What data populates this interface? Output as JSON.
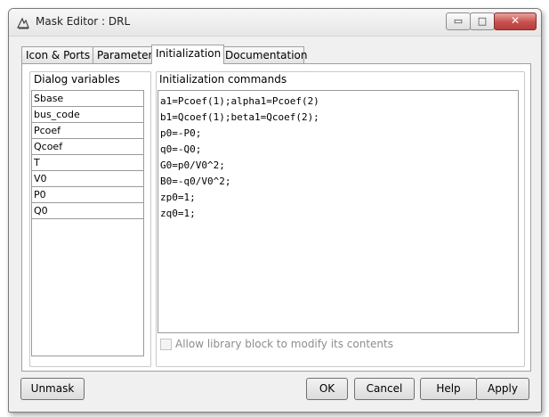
{
  "window": {
    "title": "Mask Editor : DRL"
  },
  "title_buttons": {
    "minimize": "▭",
    "maximize": "□",
    "close": "✕"
  },
  "tabs": [
    {
      "label": "Icon & Ports"
    },
    {
      "label": "Parameters"
    },
    {
      "label": "Initialization",
      "active": true
    },
    {
      "label": "Documentation"
    }
  ],
  "dialog_variables": {
    "label": "Dialog variables",
    "items": [
      "Sbase",
      "bus_code",
      "Pcoef",
      "Qcoef",
      "T",
      "V0",
      "P0",
      "Q0"
    ]
  },
  "init_commands": {
    "label": "Initialization commands",
    "lines": [
      "a1=Pcoef(1);alpha1=Pcoef(2)",
      "b1=Qcoef(1);beta1=Qcoef(2);",
      "p0=-P0;",
      "q0=-Q0;",
      "G0=p0/V0^2;",
      "B0=-q0/V0^2;",
      "zp0=1;",
      "zq0=1;"
    ]
  },
  "allow_library_label": "Allow library block to modify its contents",
  "buttons": {
    "unmask": "Unmask",
    "ok": "OK",
    "cancel": "Cancel",
    "help": "Help",
    "apply": "Apply"
  }
}
